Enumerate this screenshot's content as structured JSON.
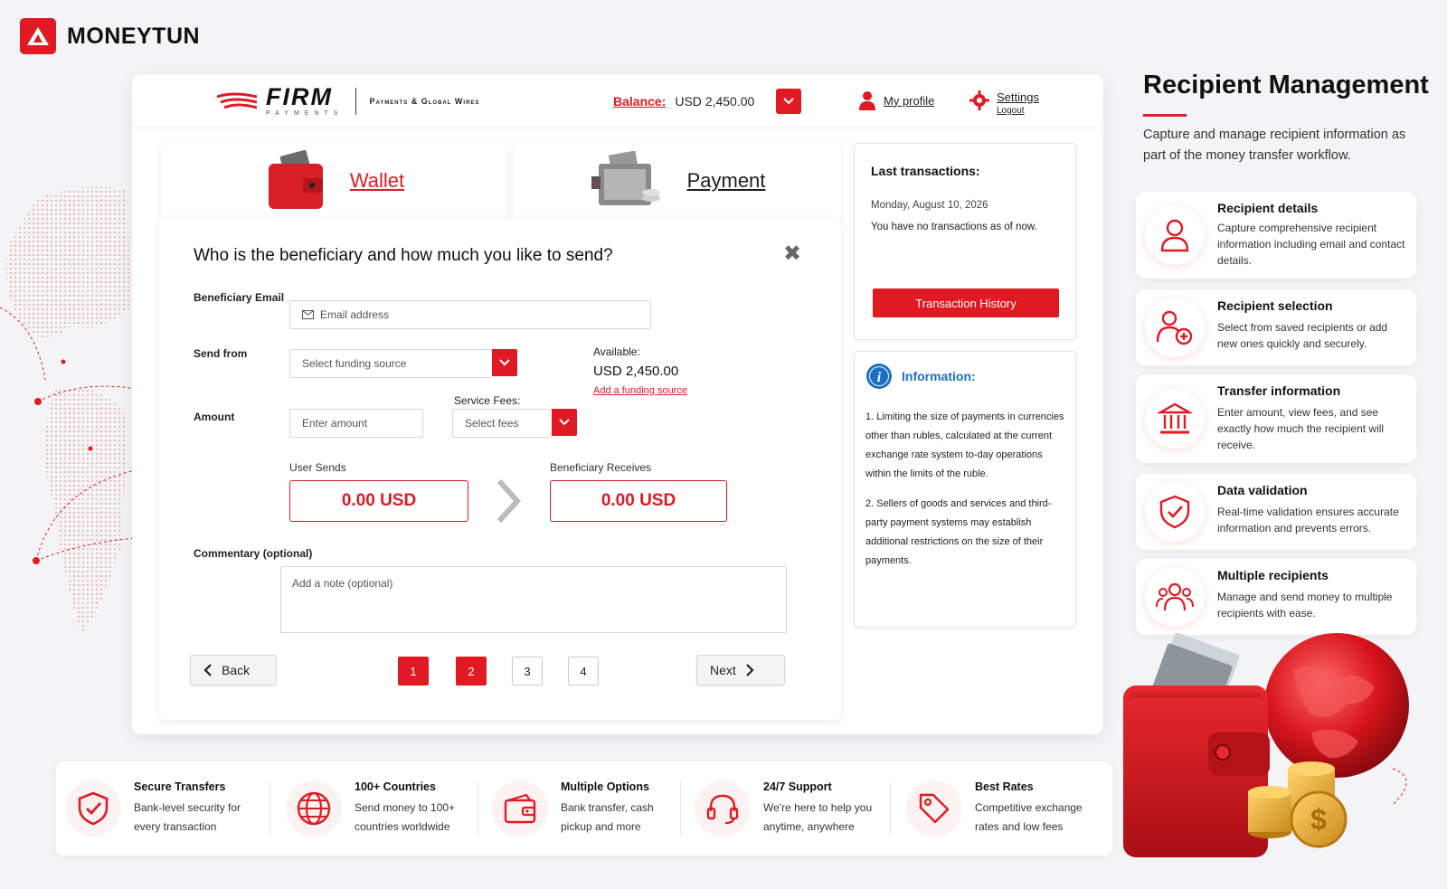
{
  "brand": {
    "name": "MONEYTUN"
  },
  "firm": {
    "name": "FIRM",
    "sub": "PAYMENTS",
    "tagline": "Payments & Global Wires"
  },
  "header": {
    "balance_label": "Balance:",
    "balance_value": "USD 2,450.00",
    "profile_label": "My profile",
    "settings_label": "Settings",
    "logout_label": "Logout"
  },
  "tabs": [
    {
      "label": "Wallet",
      "active": true
    },
    {
      "label": "Payment",
      "active": false
    }
  ],
  "form": {
    "title": "Who is the beneficiary and how much you like to send?",
    "close": "✖",
    "email_label": "Beneficiary Email",
    "email_placeholder": "Email address",
    "send_from_label": "Send from",
    "send_from_placeholder": "Select funding source",
    "available_label": "Available:",
    "available_value": "USD 2,450.00",
    "add_funding": "Add a funding source",
    "amount_label": "Amount",
    "amount_placeholder": "Enter amount",
    "service_fees_label": "Service Fees:",
    "service_fees_placeholder": "Select fees",
    "user_sends_label": "User Sends",
    "user_sends_value": "0.00 USD",
    "receives_label": "Beneficiary Receives",
    "receives_value": "0.00 USD",
    "comment_label": "Commentary (optional)",
    "comment_placeholder": "Add a note (optional)",
    "back_label": "Back",
    "next_label": "Next",
    "pages": [
      "1",
      "2",
      "3",
      "4"
    ]
  },
  "last_transactions": {
    "title": "Last transactions:",
    "date": "Monday, August 10, 2026",
    "message": "You have no transactions as of now.",
    "button": "Transaction History"
  },
  "information": {
    "title": "Information:",
    "items": [
      "1. Limiting the size of payments in currencies other than rubles, calculated at the current exchange rate system to-day operations within the limits of the ruble.",
      "2. Sellers of goods and services and third-party payment systems may establish additional restrictions on the size of their payments."
    ]
  },
  "sidebar": {
    "title": "Recipient Management",
    "description": "Capture and manage recipient information as part of the money transfer workflow.",
    "features": [
      {
        "title": "Recipient details",
        "desc": "Capture comprehensive recipient information including email and contact details.",
        "icon": "user-icon"
      },
      {
        "title": "Recipient selection",
        "desc": "Select from saved recipients or add new ones quickly and securely.",
        "icon": "user-add-icon"
      },
      {
        "title": "Transfer information",
        "desc": "Enter amount, view fees, and see exactly how much the recipient will receive.",
        "icon": "bank-icon"
      },
      {
        "title": "Data validation",
        "desc": "Real-time validation ensures accurate information and prevents errors.",
        "icon": "shield-check-icon"
      },
      {
        "title": "Multiple recipients",
        "desc": "Manage and send money to multiple recipients with ease.",
        "icon": "users-icon"
      }
    ]
  },
  "bottom": [
    {
      "title": "Secure Transfers",
      "desc": "Bank-level security for every transaction",
      "icon": "shield-check-icon"
    },
    {
      "title": "100+ Countries",
      "desc": "Send money to 100+ countries worldwide",
      "icon": "globe-icon"
    },
    {
      "title": "Multiple Options",
      "desc": "Bank transfer, cash pickup and more",
      "icon": "wallet-icon"
    },
    {
      "title": "24/7 Support",
      "desc": "We're here to help you anytime, anywhere",
      "icon": "headset-icon"
    },
    {
      "title": "Best Rates",
      "desc": "Competitive exchange rates and low fees",
      "icon": "tag-icon"
    }
  ],
  "colors": {
    "accent": "#e01a22",
    "info_blue": "#1a6fc8"
  }
}
